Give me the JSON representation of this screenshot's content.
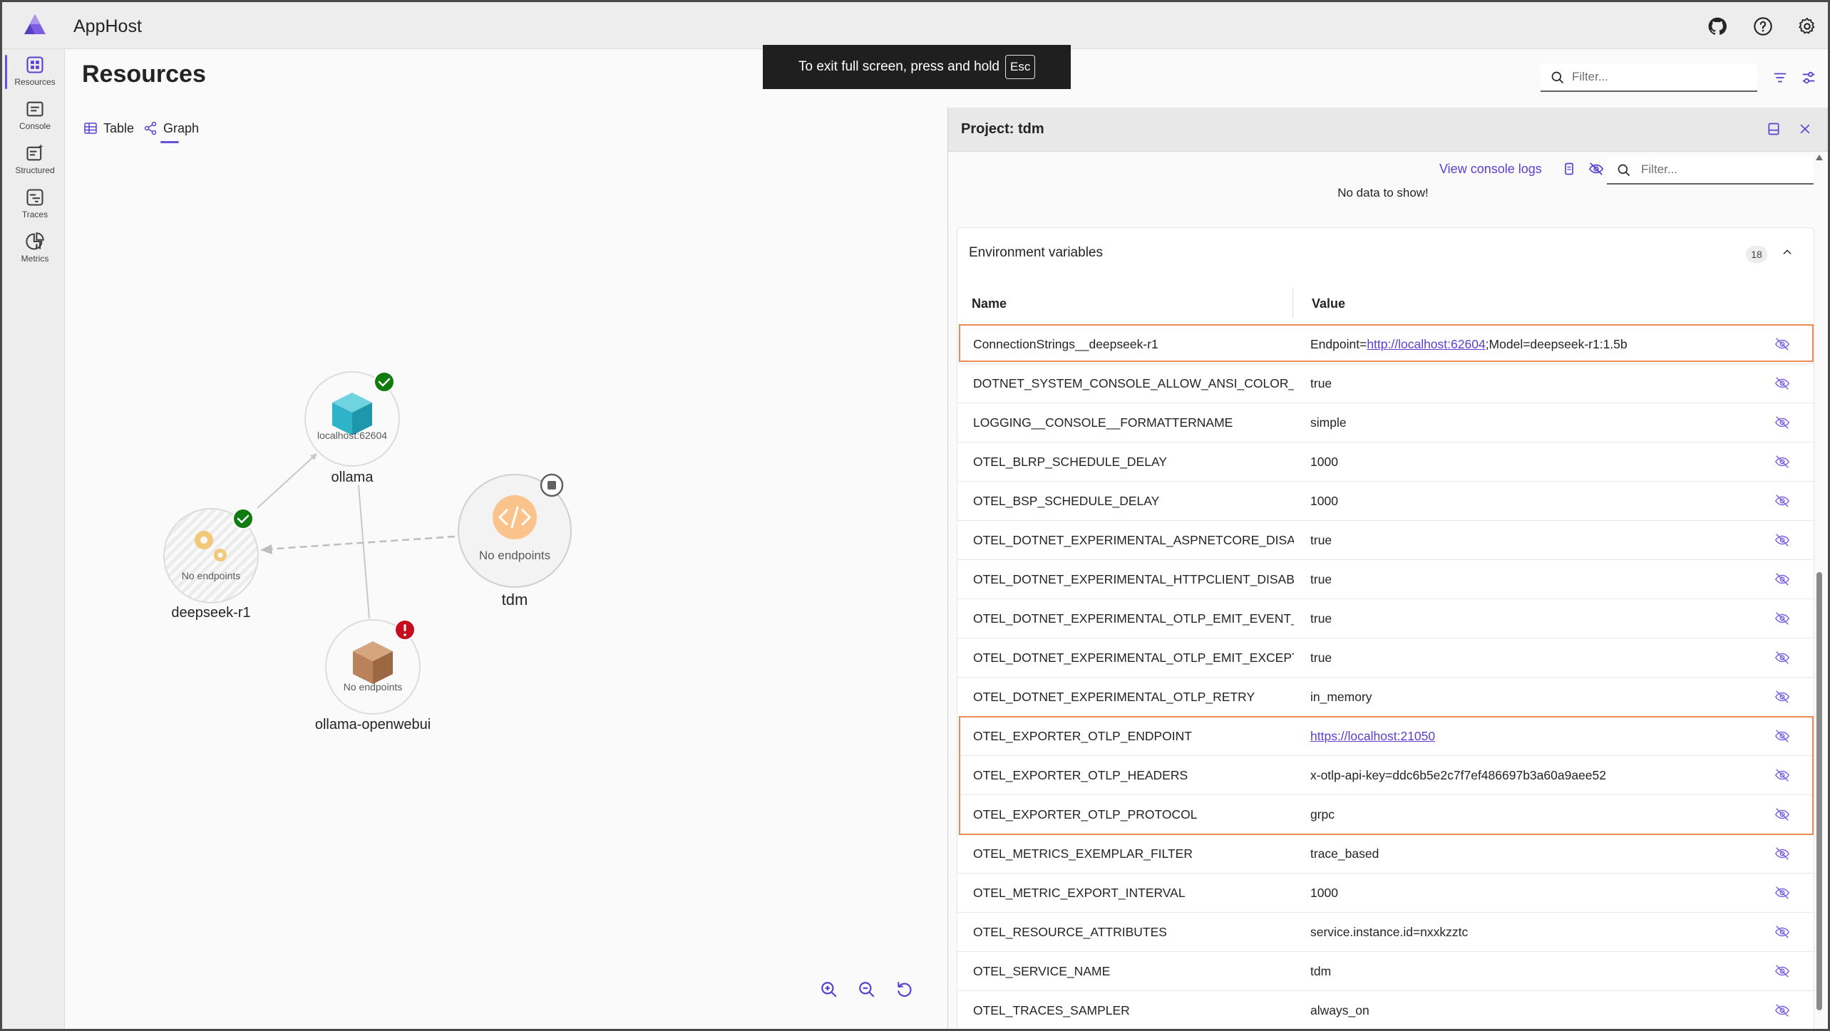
{
  "app": {
    "title": "AppHost"
  },
  "nav": [
    {
      "label": "Resources",
      "icon": "resources-icon",
      "active": true
    },
    {
      "label": "Console",
      "icon": "console-icon"
    },
    {
      "label": "Structured",
      "icon": "structured-icon"
    },
    {
      "label": "Traces",
      "icon": "traces-icon"
    },
    {
      "label": "Metrics",
      "icon": "metrics-icon"
    }
  ],
  "page": {
    "title": "Resources",
    "tabs": [
      {
        "label": "Table"
      },
      {
        "label": "Graph",
        "active": true
      }
    ],
    "filter_placeholder": "Filter..."
  },
  "toast": {
    "text": "To exit full screen, press and hold",
    "key": "Esc"
  },
  "graph": {
    "nodes": [
      {
        "id": "ollama",
        "label": "ollama",
        "sub": "localhost:62604",
        "status": "running",
        "status_color": "#107c10",
        "icon_color": "#2fb3c8"
      },
      {
        "id": "deepseek-r1",
        "label": "deepseek-r1",
        "sub": "No endpoints",
        "status": "running",
        "status_color": "#107c10",
        "icon_color": "#f2c97a"
      },
      {
        "id": "tdm",
        "label": "tdm",
        "sub": "No endpoints",
        "status": "stopped",
        "status_color": "#616161",
        "icon_color": "#f7a45b"
      },
      {
        "id": "ollama-openwebui",
        "label": "ollama-openwebui",
        "sub": "No endpoints",
        "status": "error",
        "status_color": "#c50f1f",
        "icon_color": "#b9825a"
      }
    ]
  },
  "panel": {
    "title": "Project: tdm",
    "console_link": "View console logs",
    "filter_placeholder": "Filter...",
    "nodata": "No data to show!",
    "env": {
      "title": "Environment variables",
      "count": "18",
      "col_name": "Name",
      "col_value": "Value",
      "rows": [
        {
          "name": "ConnectionStrings__deepseek-r1",
          "value_pre": "Endpoint=",
          "value_link": "http://localhost:62604",
          "value_post": ";Model=deepseek-r1:1.5b"
        },
        {
          "name": "DOTNET_SYSTEM_CONSOLE_ALLOW_ANSI_COLOR_RE...",
          "value": "true"
        },
        {
          "name": "LOGGING__CONSOLE__FORMATTERNAME",
          "value": "simple"
        },
        {
          "name": "OTEL_BLRP_SCHEDULE_DELAY",
          "value": "1000"
        },
        {
          "name": "OTEL_BSP_SCHEDULE_DELAY",
          "value": "1000"
        },
        {
          "name": "OTEL_DOTNET_EXPERIMENTAL_ASPNETCORE_DISABLE_...",
          "value": "true"
        },
        {
          "name": "OTEL_DOTNET_EXPERIMENTAL_HTTPCLIENT_DISABLE_...",
          "value": "true"
        },
        {
          "name": "OTEL_DOTNET_EXPERIMENTAL_OTLP_EMIT_EVENT_LOG...",
          "value": "true"
        },
        {
          "name": "OTEL_DOTNET_EXPERIMENTAL_OTLP_EMIT_EXCEPTION...",
          "value": "true"
        },
        {
          "name": "OTEL_DOTNET_EXPERIMENTAL_OTLP_RETRY",
          "value": "in_memory"
        },
        {
          "name": "OTEL_EXPORTER_OTLP_ENDPOINT",
          "value_link": "https://localhost:21050"
        },
        {
          "name": "OTEL_EXPORTER_OTLP_HEADERS",
          "value": "x-otlp-api-key=ddc6b5e2c7f7ef486697b3a60a9aee52"
        },
        {
          "name": "OTEL_EXPORTER_OTLP_PROTOCOL",
          "value": "grpc"
        },
        {
          "name": "OTEL_METRICS_EXEMPLAR_FILTER",
          "value": "trace_based"
        },
        {
          "name": "OTEL_METRIC_EXPORT_INTERVAL",
          "value": "1000"
        },
        {
          "name": "OTEL_RESOURCE_ATTRIBUTES",
          "value": "service.instance.id=nxxkzztc"
        },
        {
          "name": "OTEL_SERVICE_NAME",
          "value": "tdm"
        },
        {
          "name": "OTEL_TRACES_SAMPLER",
          "value": "always_on"
        }
      ]
    }
  },
  "colors": {
    "accent": "#6b4fd8",
    "link": "#5b3fd1",
    "highlight": "#f08a55"
  }
}
